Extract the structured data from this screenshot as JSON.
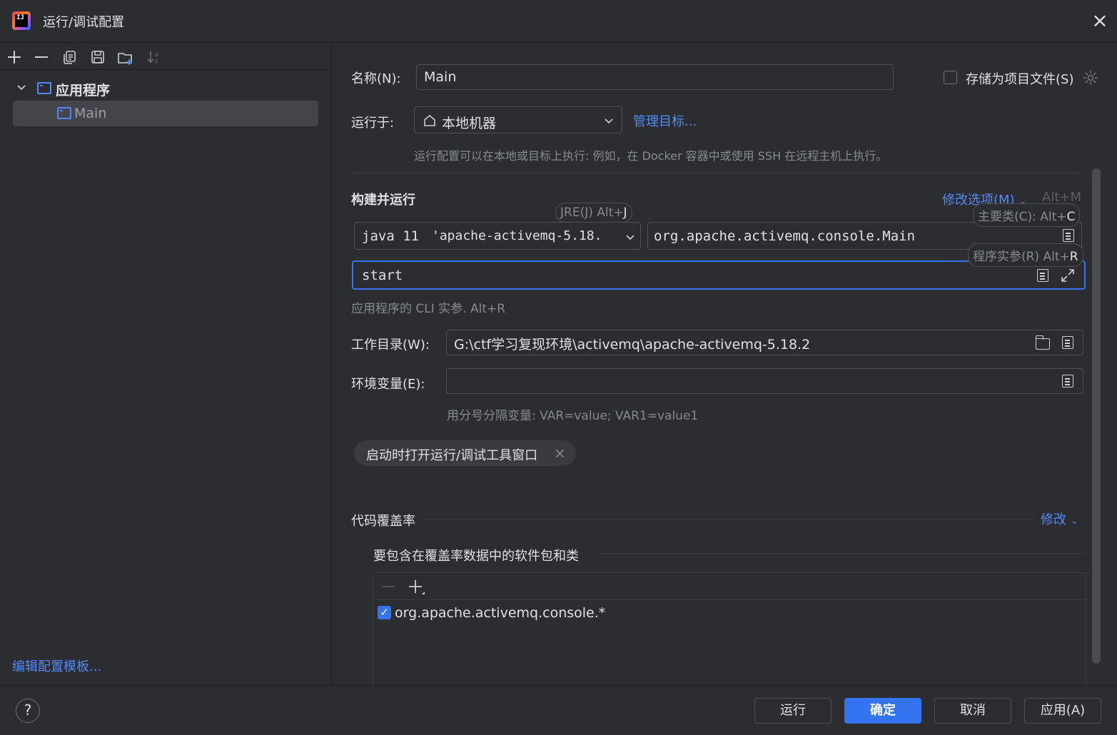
{
  "window": {
    "title": "运行/调试配置",
    "close": "×",
    "logo": "IJ"
  },
  "left": {
    "toolbar": [
      "add-icon",
      "remove-icon",
      "copy-icon",
      "save-icon",
      "new-folder-icon",
      "sort-icon"
    ],
    "tree": {
      "group_label": "应用程序",
      "child_label": "Main"
    },
    "edit_templates": "编辑配置模板..."
  },
  "form": {
    "name_label": "名称(N):",
    "name_value": "Main",
    "store_as_file": "存储为项目文件(S)",
    "run_on_label": "运行于:",
    "run_on_value": "本地机器",
    "manage_targets": "管理目标...",
    "run_on_hint": "运行配置可以在本地或目标上执行: 例如，在 Docker 容器中或使用 SSH 在远程主机上执行。",
    "build_run_header": "构建并运行",
    "modify_options": "修改选项(M)",
    "modify_options_shortcut": "Alt+M",
    "jre_hint_text": "JRE(J) Alt+",
    "jre_hint_key": "J",
    "main_class_hint_text": "主要类(C): Alt+",
    "main_class_hint_key": "C",
    "args_hint_text": "程序实参(R) Alt+",
    "args_hint_key": "R",
    "jre_value_main": "java 11",
    "jre_value_sub": "'apache-activemq-5.18.",
    "main_class_value": "org.apache.activemq.console.Main",
    "program_args_value": "start",
    "program_args_hint": "应用程序的 CLI 实参. Alt+R",
    "working_dir_label": "工作目录(W):",
    "working_dir_value": "G:\\ctf学习复现环境\\activemq\\apache-activemq-5.18.2",
    "env_label": "环境变量(E):",
    "env_value": "",
    "env_hint": "用分号分隔变量: VAR=value; VAR1=value1",
    "tag_open_tool_window": "启动时打开运行/调试工具窗口",
    "coverage_header": "代码覆盖率",
    "coverage_modify": "修改",
    "coverage_include_label": "要包含在覆盖率数据中的软件包和类",
    "coverage_items": [
      "org.apache.activemq.console.*"
    ]
  },
  "footer": {
    "help": "?",
    "run": "运行",
    "ok": "确定",
    "cancel": "取消",
    "apply": "应用(A)"
  },
  "colors": {
    "background": "#2b2d30",
    "accent": "#3574f0",
    "link": "#548af7",
    "muted": "#868a91",
    "border": "#4e5157"
  }
}
